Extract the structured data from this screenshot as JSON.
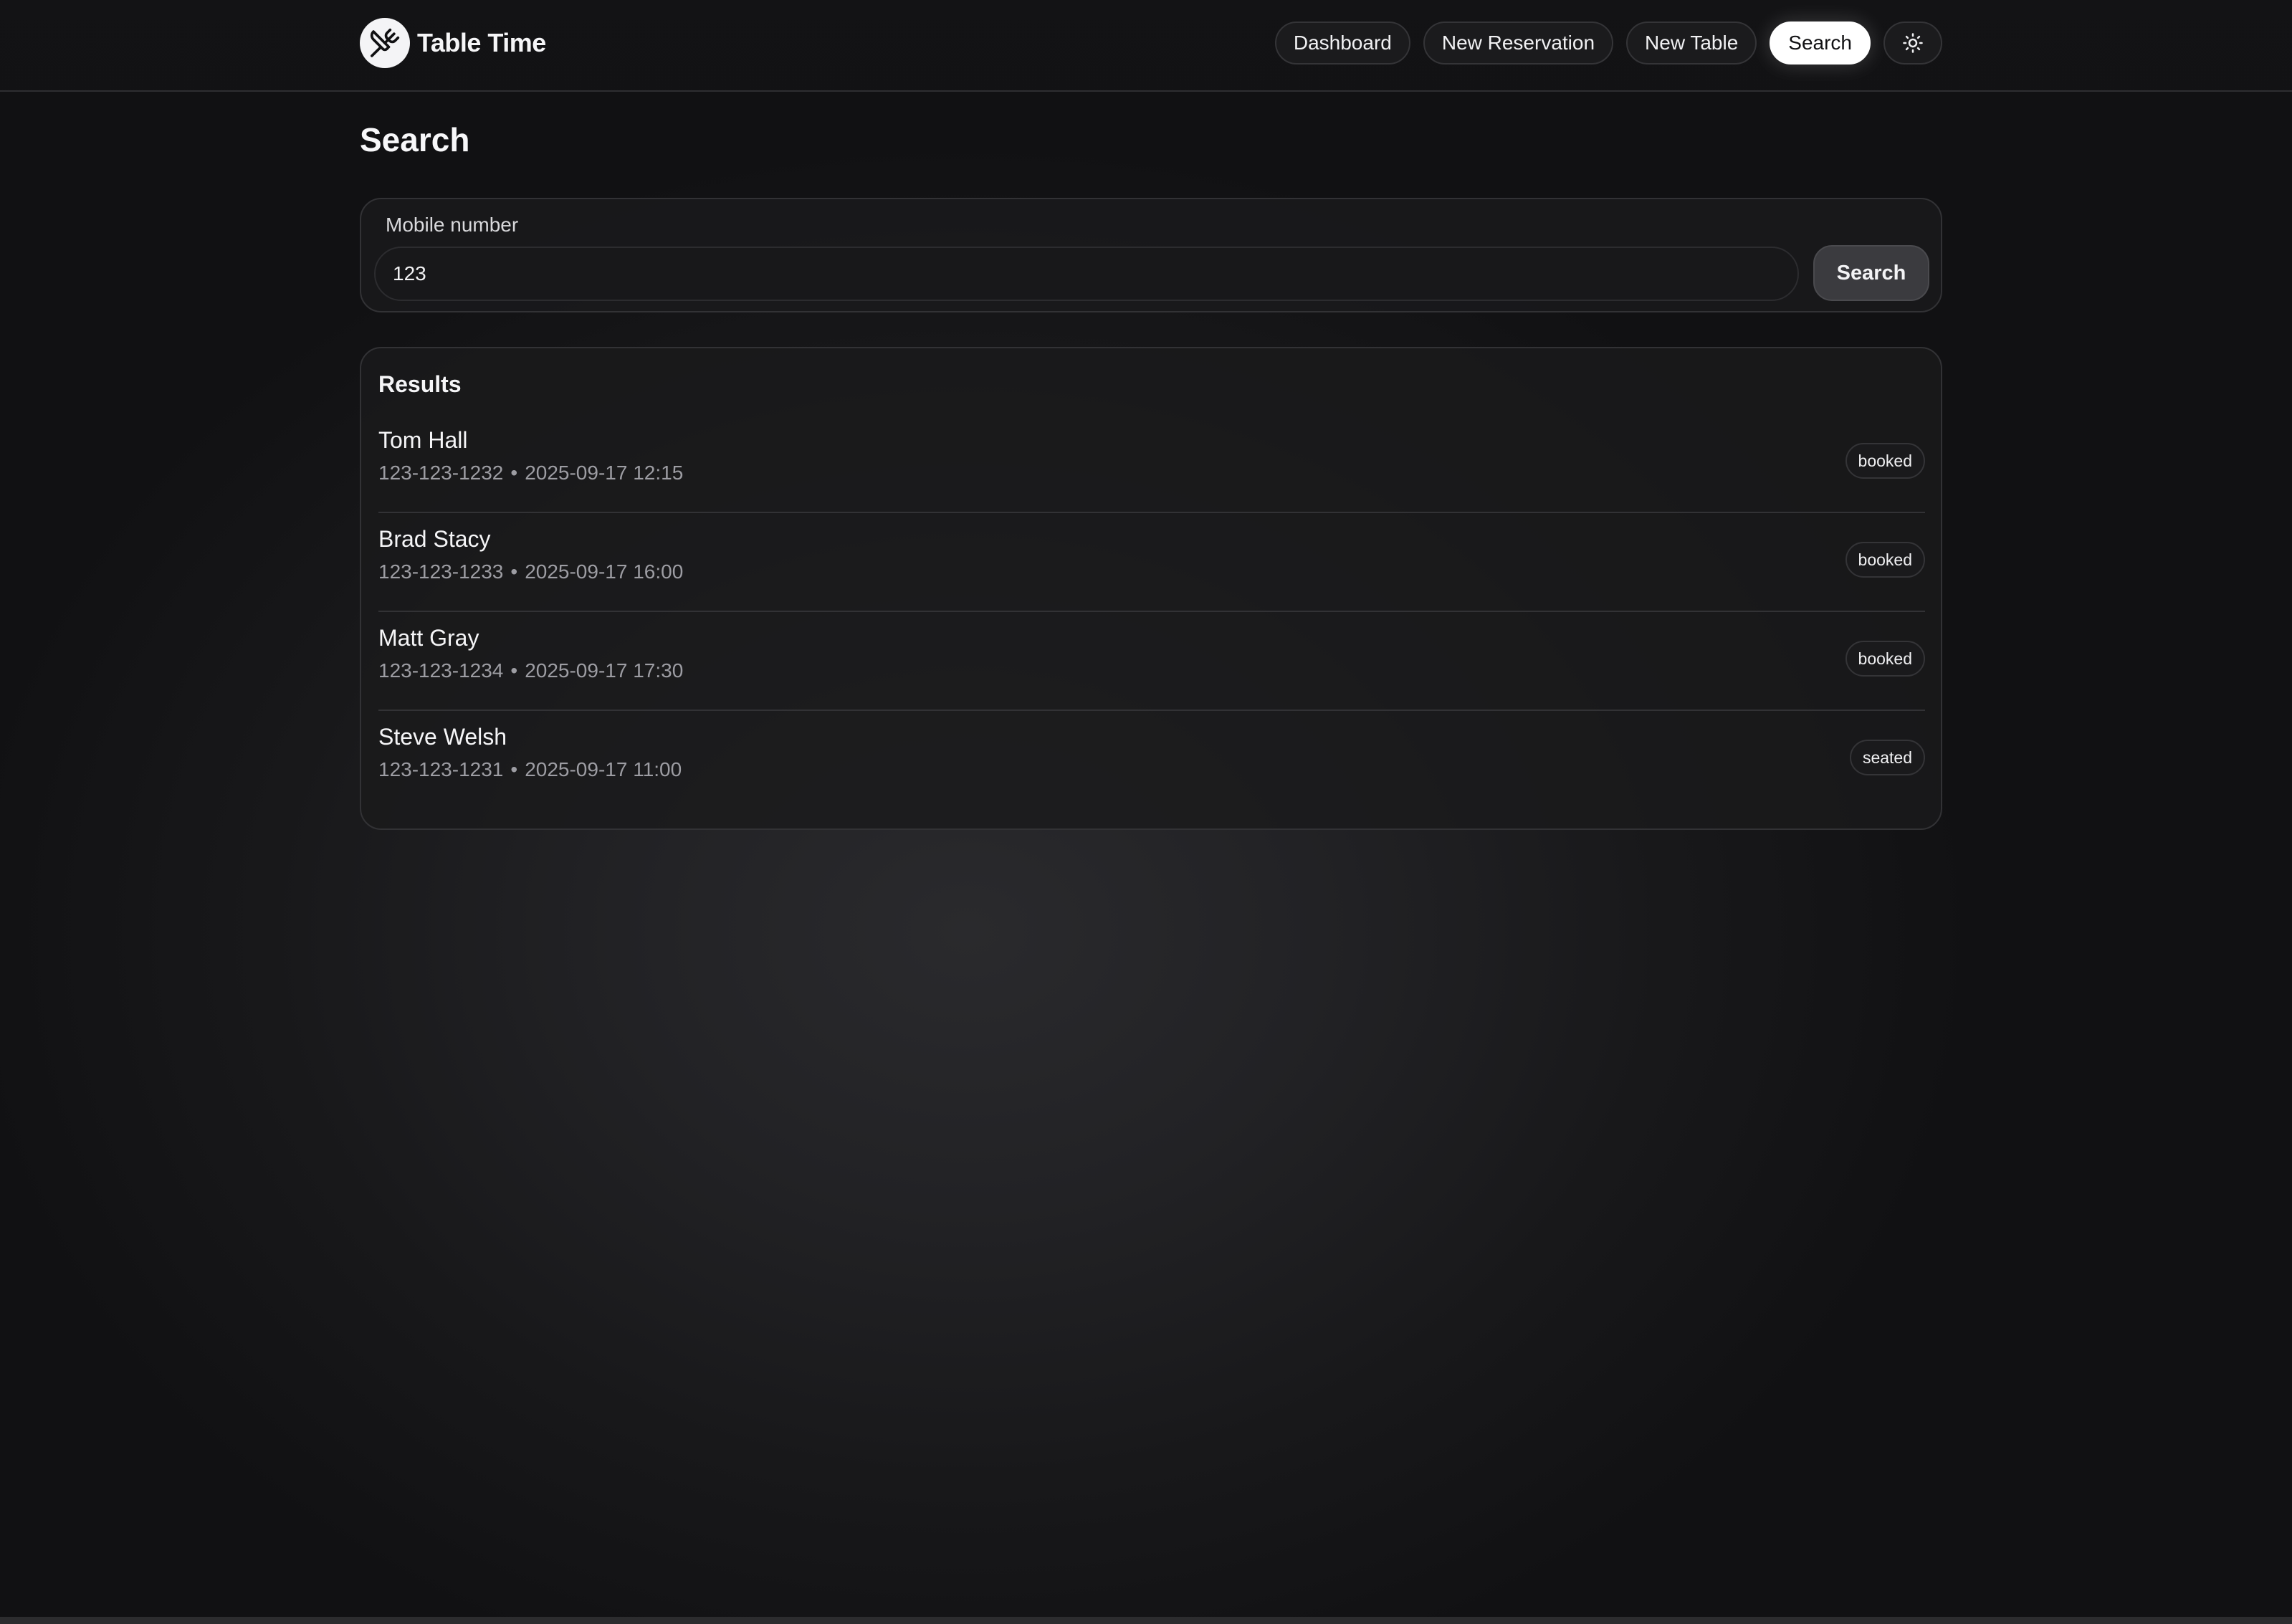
{
  "app": {
    "name": "Table Time",
    "logo_icon": "utensils-crossed-icon"
  },
  "nav": {
    "items": [
      {
        "label": "Dashboard",
        "active": false
      },
      {
        "label": "New Reservation",
        "active": false
      },
      {
        "label": "New Table",
        "active": false
      },
      {
        "label": "Search",
        "active": true
      }
    ],
    "theme_toggle_icon": "sun-icon"
  },
  "page": {
    "title": "Search"
  },
  "search": {
    "label": "Mobile number",
    "value": "123",
    "button_label": "Search"
  },
  "results": {
    "title": "Results",
    "separator": "•",
    "items": [
      {
        "name": "Tom Hall",
        "phone": "123-123-1232",
        "datetime": "2025-09-17 12:15",
        "status": "booked"
      },
      {
        "name": "Brad Stacy",
        "phone": "123-123-1233",
        "datetime": "2025-09-17 16:00",
        "status": "booked"
      },
      {
        "name": "Matt Gray",
        "phone": "123-123-1234",
        "datetime": "2025-09-17 17:30",
        "status": "booked"
      },
      {
        "name": "Steve Welsh",
        "phone": "123-123-1231",
        "datetime": "2025-09-17 11:00",
        "status": "seated"
      }
    ]
  },
  "colors": {
    "background": "#141416",
    "card_border": "#323235",
    "active_nav_bg": "#ffffff",
    "muted_text": "#9d9da3"
  }
}
